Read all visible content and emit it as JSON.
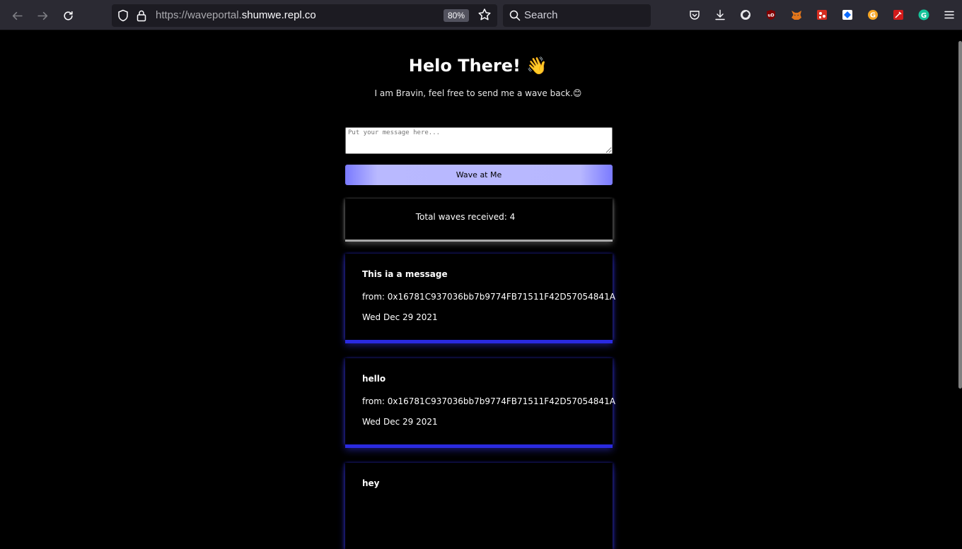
{
  "browser": {
    "url_prefix": "https://waveportal.",
    "url_domain": "shumwe.repl.co",
    "zoom": "80%",
    "search_placeholder": "Search"
  },
  "page": {
    "title": "Helo There! 👋",
    "subtitle": "I am Bravin, feel free to send me a wave back.😊",
    "message_placeholder": "Put your message here...",
    "wave_button": "Wave at Me",
    "total_waves": "Total waves received: 4",
    "waves": [
      {
        "message": "This ia a message",
        "from": "from: 0x16781C937036bb7b9774FB71511F42D57054841A",
        "date": "Wed Dec 29 2021"
      },
      {
        "message": "hello",
        "from": "from: 0x16781C937036bb7b9774FB71511F42D57054841A",
        "date": "Wed Dec 29 2021"
      },
      {
        "message": "hey",
        "from": "",
        "date": ""
      }
    ]
  },
  "colors": {
    "button_accent": "#b9b9ff",
    "card_glow": "#2a2ae0",
    "total_glow": "#a8a8a8"
  }
}
